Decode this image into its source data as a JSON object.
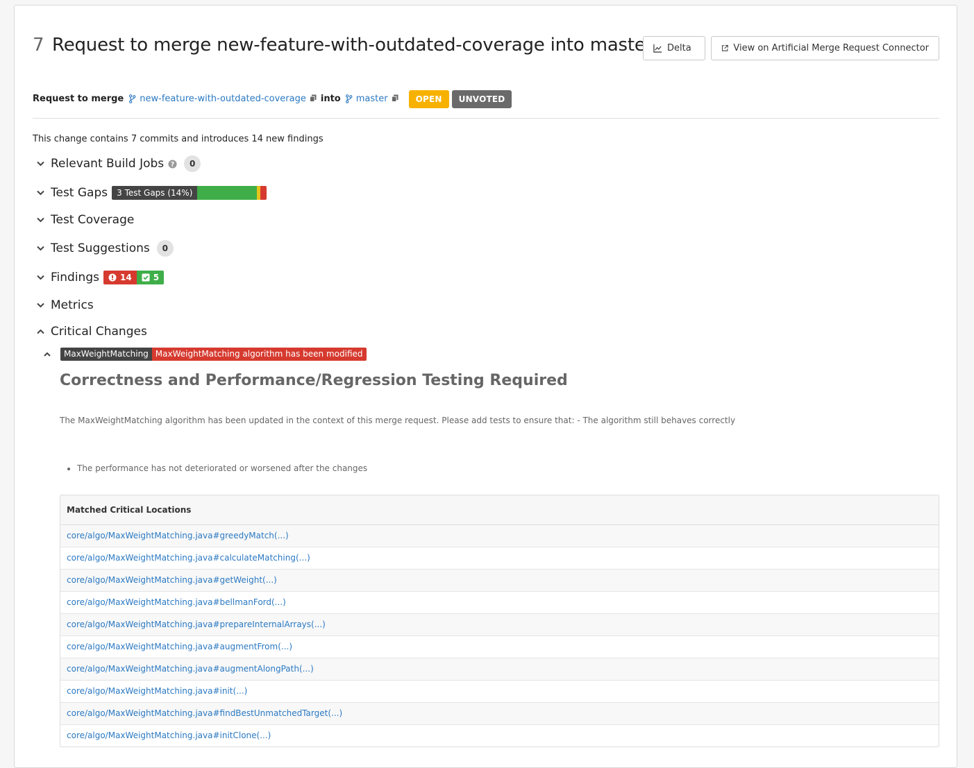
{
  "header": {
    "mr_id": "7",
    "title": "Request to merge new-feature-with-outdated-coverage into master",
    "delta_button": "Delta",
    "view_button": "View on Artificial Merge Request Connector"
  },
  "merge_info": {
    "label": "Request to merge",
    "source_branch": "new-feature-with-outdated-coverage",
    "into": "into",
    "target_branch": "master",
    "status_open": "OPEN",
    "status_vote": "UNVOTED"
  },
  "summary": "This change contains 7 commits and introduces 14 new findings",
  "sections": {
    "relevant_build_jobs": {
      "title": "Relevant Build Jobs",
      "count": "0"
    },
    "test_gaps": {
      "title": "Test Gaps",
      "badge": "3 Test Gaps (14%)",
      "fractions": {
        "green": 0.86,
        "yellow": 0.05,
        "red": 0.09
      }
    },
    "test_coverage": {
      "title": "Test Coverage"
    },
    "test_suggestions": {
      "title": "Test Suggestions",
      "count": "0"
    },
    "findings": {
      "title": "Findings",
      "red_count": "14",
      "green_count": "5"
    },
    "metrics": {
      "title": "Metrics"
    },
    "critical_changes": {
      "title": "Critical Changes"
    }
  },
  "critical_change": {
    "tag_name": "MaxWeightMatching",
    "tag_message": "MaxWeightMatching algorithm has been modified",
    "heading": "Correctness and Performance/Regression Testing Required",
    "description": "The MaxWeightMatching algorithm has been updated in the context of this merge request. Please add tests to ensure that: - The algorithm still behaves correctly",
    "bullets": [
      "The performance has not deteriorated or worsened after the changes"
    ],
    "table_header": "Matched Critical Locations",
    "locations": [
      "core/algo/MaxWeightMatching.java#greedyMatch(...)",
      "core/algo/MaxWeightMatching.java#calculateMatching(...)",
      "core/algo/MaxWeightMatching.java#getWeight(...)",
      "core/algo/MaxWeightMatching.java#bellmanFord(...)",
      "core/algo/MaxWeightMatching.java#prepareInternalArrays(...)",
      "core/algo/MaxWeightMatching.java#augmentFrom(...)",
      "core/algo/MaxWeightMatching.java#augmentAlongPath(...)",
      "core/algo/MaxWeightMatching.java#init(...)",
      "core/algo/MaxWeightMatching.java#findBestUnmatchedTarget(...)",
      "core/algo/MaxWeightMatching.java#initClone(...)"
    ]
  },
  "colors": {
    "link": "#2b79c2",
    "open": "#f7b100",
    "unvoted": "#6a6a6a",
    "gap_green": "#3fae49",
    "gap_yellow": "#e8c31c",
    "gap_red": "#d63a2f"
  }
}
